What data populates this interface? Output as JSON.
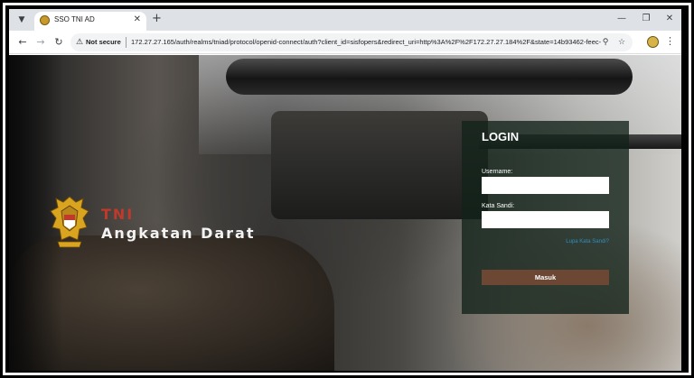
{
  "browser": {
    "tab": {
      "title": "SSO TNI AD"
    },
    "address": {
      "security_label": "Not secure",
      "url": "172.27.27.165/auth/realms/tniad/protocol/openid-connect/auth?client_id=sisfopers&redirect_uri=http%3A%2F%2F172.27.27.184%2F&state=14b93462-feec-..."
    },
    "icons": {
      "tab_search": "chevron-down-icon",
      "favicon": "tni-ad-favicon",
      "tab_close": "close-icon",
      "new_tab": "plus-icon",
      "minimize": "minimize-icon",
      "restore": "restore-icon",
      "close_window": "close-icon",
      "back": "arrow-left-icon",
      "forward": "arrow-right-icon",
      "reload": "reload-icon",
      "warning": "warning-triangle-icon",
      "key": "key-icon",
      "bookmark": "star-icon",
      "extension": "extension-icon",
      "menu": "kebab-menu-icon"
    }
  },
  "brand": {
    "line1": "TNI",
    "line2": "Angkatan Darat",
    "line1_color": "#c0392b"
  },
  "login": {
    "title": "LOGIN",
    "username_label": "Username:",
    "username_value": "",
    "password_label": "Kata Sandi:",
    "password_value": "",
    "forgot_label": "Lupa Kata Sandi?",
    "submit_label": "Masuk",
    "button_color": "#6b4734",
    "link_color": "#2f8fbf"
  }
}
